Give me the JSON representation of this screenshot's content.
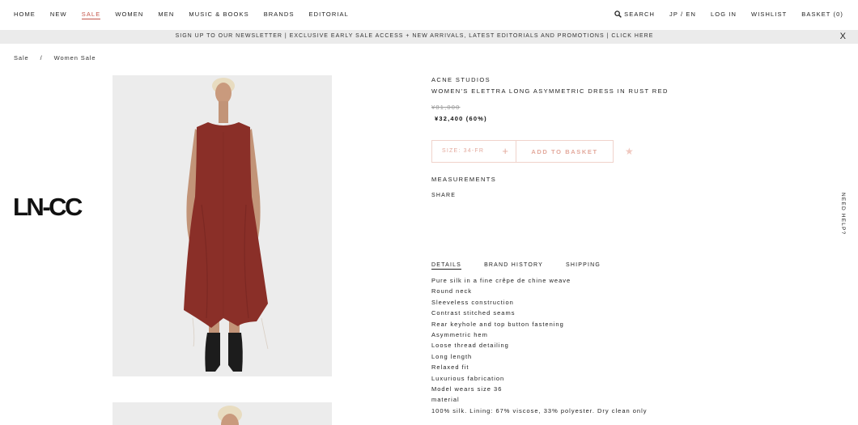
{
  "nav": {
    "left": [
      "HOME",
      "NEW",
      "SALE",
      "WOMEN",
      "MEN",
      "MUSIC & BOOKS",
      "BRANDS",
      "EDITORIAL"
    ],
    "active": "SALE",
    "search": "SEARCH",
    "lang": "JP / EN",
    "login": "LOG IN",
    "wishlist": "WISHLIST",
    "basket": "BASKET (0)"
  },
  "newsletter": {
    "text": "SIGN UP TO OUR NEWSLETTER | EXCLUSIVE EARLY SALE ACCESS + NEW ARRIVALS, LATEST EDITORIALS AND PROMOTIONS | CLICK HERE",
    "close": "X"
  },
  "breadcrumb": [
    "Sale",
    "Women Sale"
  ],
  "breadcrumb_sep": "/",
  "logo": "LN-CC",
  "product": {
    "brand": "ACNE STUDIOS",
    "name": "WOMEN'S ELETTRA LONG ASYMMETRIC DRESS IN RUST RED",
    "old_price": "¥81,000",
    "new_price": "¥32,400  (60%)",
    "size_label": "SIZE: 34-FR",
    "add_label": "ADD TO BASKET",
    "measurements": "MEASUREMENTS",
    "share": "SHARE"
  },
  "tabs": [
    "DETAILS",
    "BRAND HISTORY",
    "SHIPPING"
  ],
  "details": [
    "Pure silk in a fine crêpe de chine weave",
    "Round neck",
    "Sleeveless construction",
    "Contrast stitched seams",
    "Rear keyhole and top button fastening",
    "Asymmetric hem",
    "Loose thread detailing",
    "Long length",
    "Relaxed fit",
    "Luxurious fabrication",
    "Model wears size 36",
    "material",
    "100% silk. Lining: 67% viscose, 33% polyester. Dry clean only"
  ],
  "need_help": "NEED HELP?",
  "colors": {
    "accent": "#c4564a",
    "dress": "#8a2f28",
    "button_border": "#f0d3cb"
  }
}
